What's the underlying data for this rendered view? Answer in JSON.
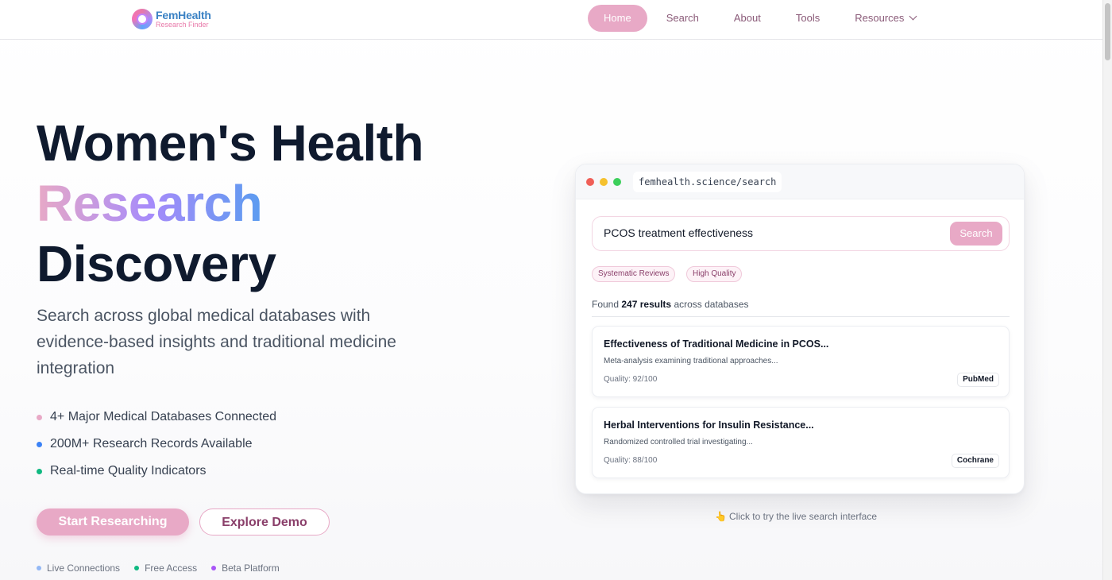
{
  "nav": {
    "logo_title": "FemHealth",
    "logo_sub": "Research Finder",
    "links": [
      "Home",
      "Search",
      "About",
      "Tools",
      "Resources"
    ]
  },
  "hero": {
    "title_line1": "Women's Health",
    "title_line2": "Research",
    "title_line3": "Discovery",
    "subtitle": "Search across global medical databases with evidence-based insights and traditional medicine integration",
    "features": [
      {
        "text": "4+ Major Medical Databases Connected",
        "color": "#e8a9c6"
      },
      {
        "text": "200M+ Research Records Available",
        "color": "#3b82f6"
      },
      {
        "text": "Real-time Quality Indicators",
        "color": "#10b981"
      }
    ],
    "primary_button": "Start Researching",
    "secondary_button": "Explore Demo",
    "status": [
      {
        "text": "Live Connections",
        "color": "#93b8f5"
      },
      {
        "text": "Free Access",
        "color": "#10b981"
      },
      {
        "text": "Beta Platform",
        "color": "#a855f7"
      }
    ]
  },
  "demo": {
    "url": "femhealth.science/search",
    "traffic_lights": [
      "#f05f57",
      "#f5c12e",
      "#3ccf5b"
    ],
    "search_query": "PCOS treatment effectiveness",
    "search_button": "Search",
    "tags": [
      "Systematic Reviews",
      "High Quality"
    ],
    "found_prefix": "Found",
    "found_count": "247 results",
    "found_suffix": "across databases",
    "results": [
      {
        "title": "Effectiveness of Traditional Medicine in PCOS...",
        "desc": "Meta-analysis examining traditional approaches...",
        "quality": "Quality: 92/100",
        "source": "PubMed"
      },
      {
        "title": "Herbal Interventions for Insulin Resistance...",
        "desc": "Randomized controlled trial investigating...",
        "quality": "Quality: 88/100",
        "source": "Cochrane"
      }
    ],
    "hint": "Click to try the live search interface",
    "hint_icon": "👆"
  }
}
